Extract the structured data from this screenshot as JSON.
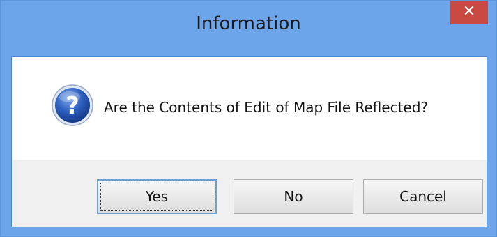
{
  "window": {
    "title": "Information",
    "close_glyph": "✕",
    "colors": {
      "titlebar": "#6ca5ea",
      "close_button": "#c94a42"
    }
  },
  "dialog": {
    "icon": "question-icon",
    "message": "Are the Contents of Edit of Map File Reflected?"
  },
  "buttons": {
    "yes": "Yes",
    "no": "No",
    "cancel": "Cancel"
  }
}
